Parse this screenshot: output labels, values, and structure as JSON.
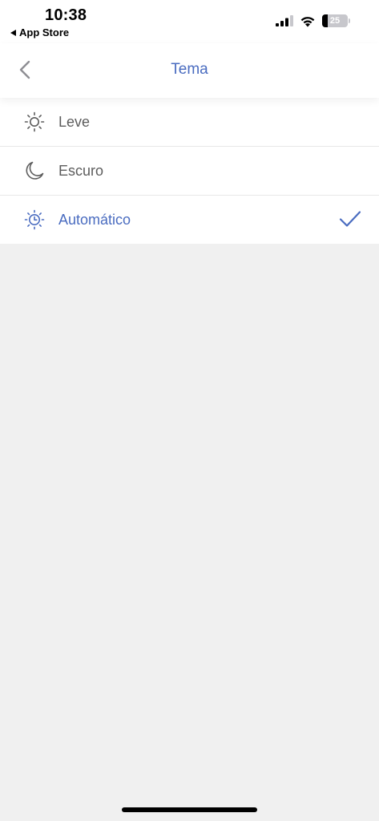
{
  "status_bar": {
    "time": "10:38",
    "back_app_label": "App Store",
    "battery_percent": "25",
    "icons": [
      "cellular-signal-icon",
      "wifi-icon",
      "battery-icon"
    ]
  },
  "nav": {
    "title": "Tema",
    "back_icon": "chevron-left-icon"
  },
  "colors": {
    "accent": "#4a6cc0",
    "text": "#5c5c5c",
    "background": "#f0f0f0"
  },
  "theme_options": [
    {
      "label": "Leve",
      "icon": "sun-icon",
      "selected": false
    },
    {
      "label": "Escuro",
      "icon": "moon-icon",
      "selected": false
    },
    {
      "label": "Automático",
      "icon": "sun-clock-icon",
      "selected": true
    }
  ]
}
